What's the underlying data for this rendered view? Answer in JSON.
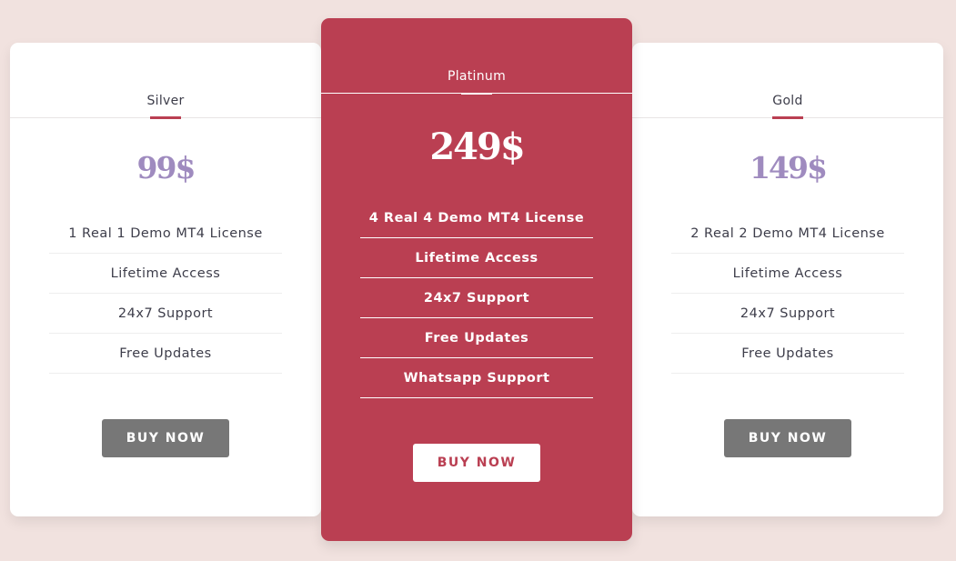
{
  "colors": {
    "background": "#f1e2df",
    "accent": "#ba3f52",
    "price": "#9f8bbf",
    "button": "#777777"
  },
  "plans": [
    {
      "name": "Silver",
      "price": "99$",
      "features": [
        "1 Real 1 Demo MT4 License",
        "Lifetime Access",
        "24x7 Support",
        "Free Updates"
      ],
      "button": "BUY NOW"
    },
    {
      "name": "Platinum",
      "price": "249$",
      "features": [
        "4 Real 4 Demo MT4 License",
        "Lifetime Access",
        "24x7 Support",
        "Free Updates",
        "Whatsapp Support"
      ],
      "button": "BUY NOW"
    },
    {
      "name": "Gold",
      "price": "149$",
      "features": [
        "2 Real 2 Demo MT4 License",
        "Lifetime Access",
        "24x7 Support",
        "Free Updates"
      ],
      "button": "BUY NOW"
    }
  ]
}
